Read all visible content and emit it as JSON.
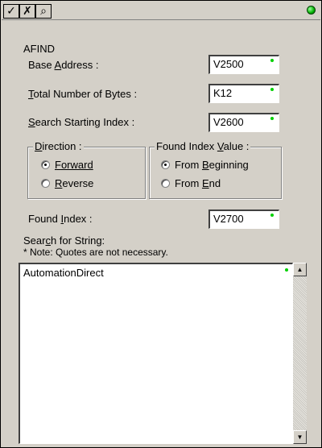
{
  "toolbar": {
    "ok_glyph": "✓",
    "cancel_glyph": "✗",
    "help_glyph": "⌕"
  },
  "title": "AFIND",
  "fields": {
    "base_address": {
      "label_prefix": "Base ",
      "label_accel": "A",
      "label_suffix": "ddress :",
      "value": "V2500"
    },
    "total_bytes": {
      "label_accel": "T",
      "label_suffix": "otal Number of Bytes :",
      "value": "K12"
    },
    "search_start": {
      "label_accel": "S",
      "label_suffix": "earch Starting Index :",
      "value": "V2600"
    },
    "found_index": {
      "label_prefix": "Found ",
      "label_accel": "I",
      "label_suffix": "ndex :",
      "value": "V2700"
    }
  },
  "direction": {
    "title_accel": "D",
    "title_suffix": "irection :",
    "options": [
      {
        "accel": "F",
        "rest": "orward",
        "selected": true
      },
      {
        "accel": "R",
        "rest": "everse",
        "selected": false
      }
    ]
  },
  "found_value": {
    "title_prefix": "Found Index ",
    "title_accel": "V",
    "title_suffix": "alue :",
    "options": [
      {
        "prefix": "From ",
        "accel": "B",
        "rest": "eginning",
        "selected": true
      },
      {
        "prefix": "From ",
        "accel": "E",
        "rest": "nd",
        "selected": false
      }
    ]
  },
  "search_string": {
    "label_prefix": "Sear",
    "label_accel": "c",
    "label_suffix": "h for String:",
    "note": "* Note: Quotes are not necessary.",
    "value": "AutomationDirect"
  },
  "status_color": "#00b000"
}
